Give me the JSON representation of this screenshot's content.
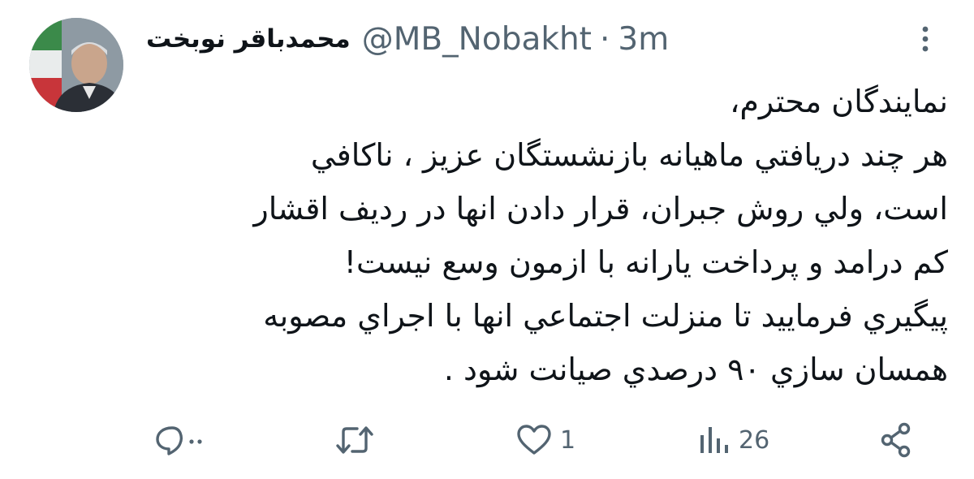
{
  "tweet": {
    "author": {
      "display_name": "محمدباقر نوبخت",
      "handle": "@MB_Nobakht",
      "separator": "·",
      "time": "3m"
    },
    "avatar_icon": "profile-photo",
    "lines": [
      "نمايندگان محترم،",
      "هر چند دريافتي ماهيانه بازنشستگان عزيز ، ناكافي",
      "است، ولي روش جبران، قرار دادن انها  در رديف اقشار",
      "كم درامد و پرداخت يارانه با ازمون وسع نيست!",
      "پيگيري فرماييد تا منزلت اجتماعي انها با اجراي مصوبه",
      "همسان سازي ۹۰ درصدي صيانت شود ."
    ],
    "actions": {
      "reply_count": "",
      "retweet_count": "",
      "like_count": "1",
      "views_count": "26"
    },
    "colors": {
      "text": "#0f1419",
      "muted": "#536471"
    }
  }
}
